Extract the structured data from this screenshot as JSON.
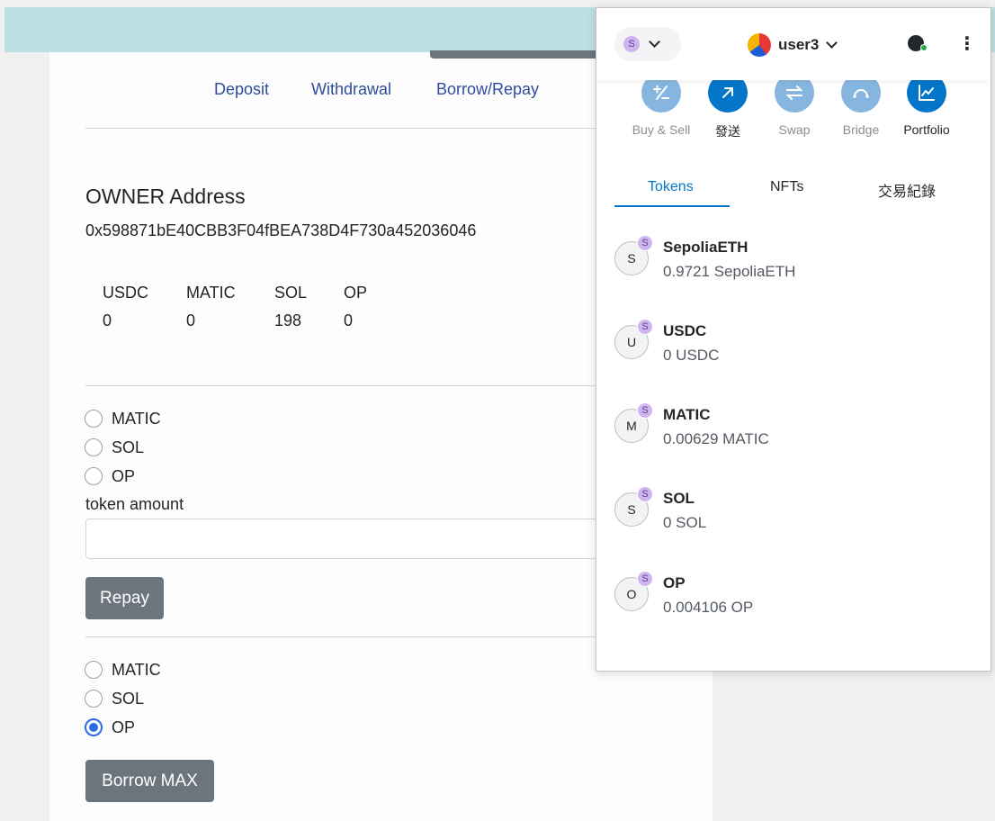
{
  "dapp": {
    "nav": [
      "Deposit",
      "Withdrawal",
      "Borrow/Repay"
    ],
    "owner_title": "OWNER Address",
    "owner_address": "0x598871bE40CBB3F04fBEA738D4F730a452036046",
    "balances": [
      {
        "symbol": "USDC",
        "amount": "0"
      },
      {
        "symbol": "MATIC",
        "amount": "0"
      },
      {
        "symbol": "SOL",
        "amount": "198"
      },
      {
        "symbol": "OP",
        "amount": "0"
      }
    ],
    "repay_section": {
      "options": [
        "MATIC",
        "SOL",
        "OP"
      ],
      "selected": null,
      "amount_label": "token amount",
      "amount_value": "",
      "button": "Repay"
    },
    "borrow_section": {
      "options": [
        "MATIC",
        "SOL",
        "OP"
      ],
      "selected": "OP",
      "button": "Borrow MAX"
    }
  },
  "wallet": {
    "network_badge": "S",
    "account_name": "user3",
    "actions": [
      {
        "label": "Buy & Sell",
        "icon": "buy-sell-icon",
        "enabled": false
      },
      {
        "label": "發送",
        "icon": "send-arrow-icon",
        "enabled": true
      },
      {
        "label": "Swap",
        "icon": "swap-icon",
        "enabled": false
      },
      {
        "label": "Bridge",
        "icon": "bridge-icon",
        "enabled": false
      },
      {
        "label": "Portfolio",
        "icon": "portfolio-chart-icon",
        "enabled": true
      }
    ],
    "tabs": [
      "Tokens",
      "NFTs",
      "交易紀錄"
    ],
    "active_tab": "Tokens",
    "tokens": [
      {
        "letter": "S",
        "badge": "S",
        "name": "SepoliaETH",
        "balance": "0.9721 SepoliaETH"
      },
      {
        "letter": "U",
        "badge": "S",
        "name": "USDC",
        "balance": "0 USDC"
      },
      {
        "letter": "M",
        "badge": "S",
        "name": "MATIC",
        "balance": "0.00629 MATIC"
      },
      {
        "letter": "S",
        "badge": "S",
        "name": "SOL",
        "balance": "0 SOL"
      },
      {
        "letter": "O",
        "badge": "S",
        "name": "OP",
        "balance": "0.004106 OP"
      }
    ]
  },
  "colors": {
    "topbar": "#bde0e2",
    "nav_link": "#2d4d9c",
    "button_gray": "#6c757d",
    "radio_checked": "#2d6cdf",
    "action_active": "#0376c9",
    "action_disabled": "#86b6e0",
    "tab_underline": "#0376c9",
    "badge_purple": "#cfb5f0"
  }
}
